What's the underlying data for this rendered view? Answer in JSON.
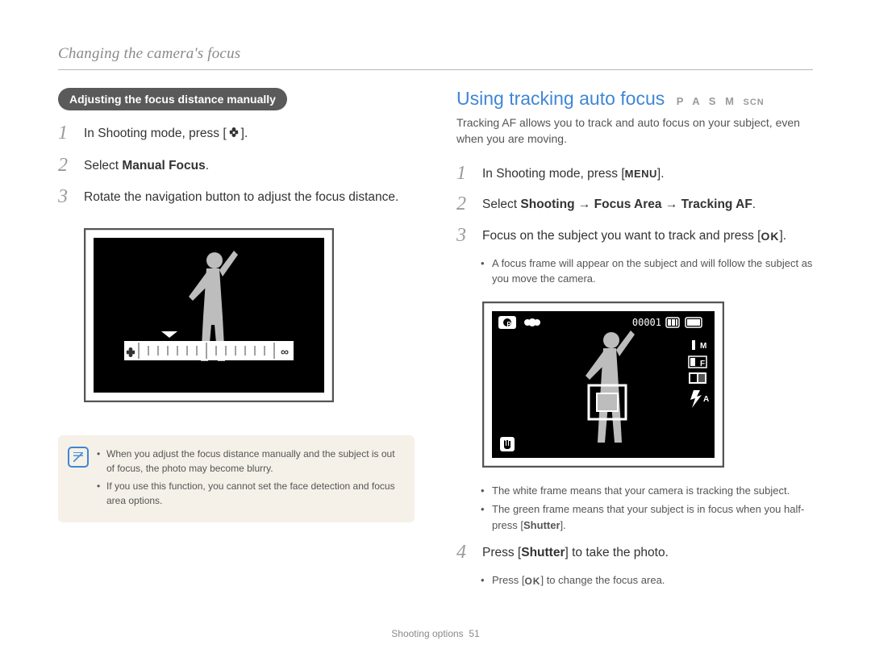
{
  "header": "Changing the camera's focus",
  "left": {
    "pill": "Adjusting the focus distance manually",
    "step1_a": "In Shooting mode, press [",
    "step1_b": "].",
    "step2_a": "Select ",
    "step2_b": "Manual Focus",
    "step2_c": ".",
    "step3": "Rotate the navigation button to adjust the focus distance.",
    "note1": "When you adjust the focus distance manually and the subject is out of focus, the photo may become blurry.",
    "note2": "If you use this function, you cannot set the face detection and focus area options."
  },
  "right": {
    "title": "Using tracking auto focus",
    "modes": "P A S M",
    "mode_scn": "SCN",
    "intro": "Tracking AF allows you to track and auto focus on your subject, even when you are moving.",
    "step1_a": "In Shooting mode, press [",
    "step1_b": "].",
    "menu_label": "MENU",
    "step2_a": "Select ",
    "step2_b": "Shooting",
    "step2_arrow": " → ",
    "step2_c": "Focus Area",
    "step2_d": "Tracking AF",
    "step2_e": ".",
    "step3_a": "Focus on  the subject you want to track and press [",
    "step3_b": "].",
    "ok_label": "OK",
    "sub3_1": "A focus frame will appear on the subject and will follow the subject as you move the camera.",
    "counter": "00001",
    "overlay_m": "M",
    "overlay_f": "F",
    "overlay_flash": "A",
    "bullet_after_a": "The white frame means that your camera is tracking the subject.",
    "bullet_after_b_1": "The green frame means that your subject is in focus when you half-press [",
    "bullet_after_b_2": "Shutter",
    "bullet_after_b_3": "].",
    "step4_a": "Press [",
    "step4_b": "Shutter",
    "step4_c": "] to take the photo.",
    "sub4_1a": "Press [",
    "sub4_1b": "] to change the focus area."
  },
  "footer_label": "Shooting options",
  "footer_page": "51"
}
